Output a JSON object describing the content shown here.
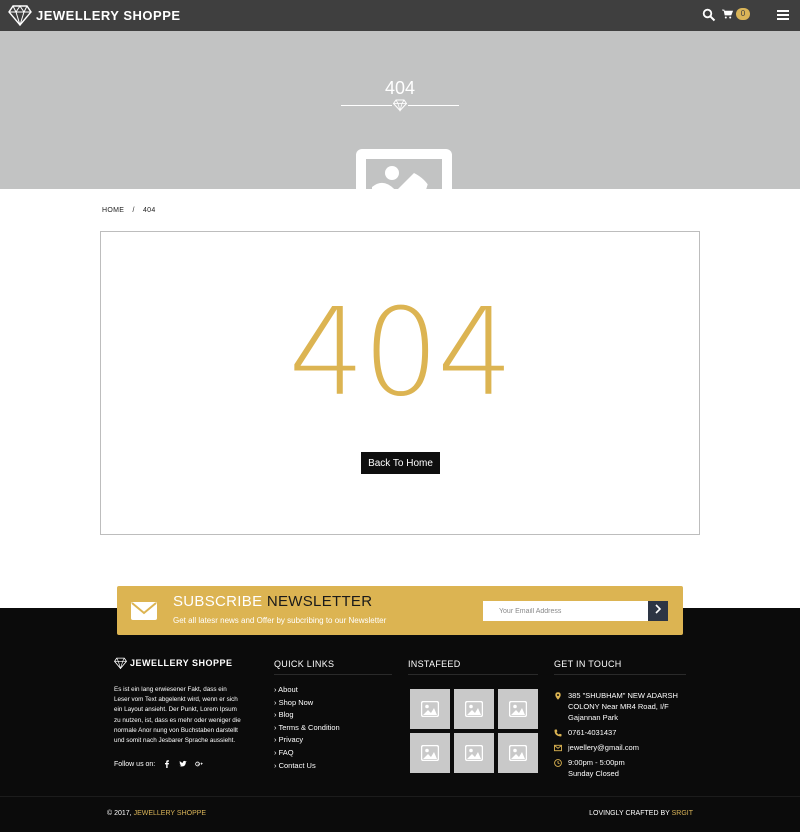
{
  "header": {
    "brand": "JEWELLERY SHOPPE",
    "cart_count": "0"
  },
  "hero": {
    "title": "404"
  },
  "breadcrumb": {
    "home": "HOME",
    "separator": "/",
    "current": "404"
  },
  "error": {
    "code": "404",
    "back_button": "Back To Home"
  },
  "newsletter": {
    "title_light": "SUBSCRIBE",
    "title_dark": "NEWSLETTER",
    "subtitle": "Get all latesr news and Offer by subcribing to our Newsletter",
    "placeholder": "Your Emaill Address"
  },
  "footer": {
    "about": {
      "brand": "JEWELLERY SHOPPE",
      "text": "Es ist ein lang erwiesener Fakt, dass ein Leser vom Text abgelenkt wird, wenn er sich ein Layout ansieht. Der Punkt, Lorem Ipsum zu nutzen, ist, dass es mehr oder weniger die normale Anor nung von Buchstaben darstellt und somit nach Jesbarer Sprache aussieht.",
      "follow_label": "Follow us on:"
    },
    "quick_links": {
      "title": "QUICK LINKS",
      "items": [
        "About",
        "Shop Now",
        "Blog",
        "Terms & Condition",
        "Privacy",
        "FAQ",
        "Contact Us"
      ]
    },
    "instafeed": {
      "title": "INSTAFEED"
    },
    "contact": {
      "title": "GET IN TOUCH",
      "address": "385 \"SHUBHAM\" NEW ADARSH COLONY Near MR4 Road, I/F Gajannan Park",
      "phone": "0761-4031437",
      "email": "jewellery@gmail.com",
      "hours": "9:00pm - 5:00pm",
      "closed": "Sunday Closed"
    }
  },
  "bottom": {
    "copy_prefix": "© 2017,",
    "copy_brand": "JEWELLERY SHOPPE",
    "credit_prefix": "LOVINGLY CRAFTED BY",
    "credit_brand": "SRGIT"
  },
  "colors": {
    "accent": "#dcb452",
    "header": "#3f3f3f",
    "hero": "#c2c3c3",
    "footer": "#0b0b0b",
    "button_dark": "#2d3544"
  },
  "icons": [
    "diamond-logo-icon",
    "search-icon",
    "cart-icon",
    "hamburger-menu-icon",
    "image-placeholder-icon",
    "envelope-icon",
    "chevron-right-icon",
    "map-pin-icon",
    "phone-icon",
    "mail-icon",
    "clock-icon",
    "facebook-icon",
    "twitter-icon",
    "google-plus-icon"
  ]
}
